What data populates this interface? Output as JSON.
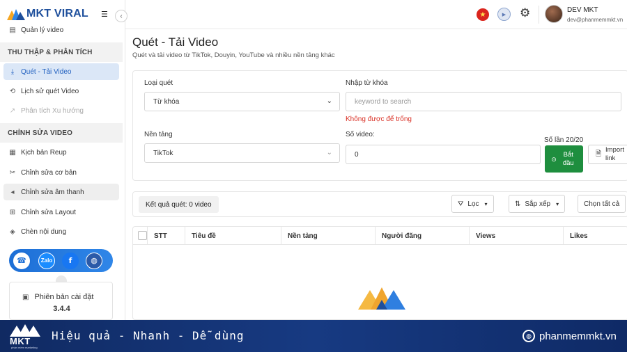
{
  "app": {
    "brand": "MKT VIRAL"
  },
  "sidebar": {
    "top_item": "Quản lý video",
    "sections": [
      {
        "title": "THU THẬP & PHÂN TÍCH",
        "items": [
          {
            "label": "Quét - Tải Video",
            "icon": "download-icon",
            "state": "active"
          },
          {
            "label": "Lịch sử quét Video",
            "icon": "history-icon",
            "state": "normal"
          },
          {
            "label": "Phân tích Xu hướng",
            "icon": "trend-icon",
            "state": "disabled"
          }
        ]
      },
      {
        "title": "CHỈNH SỬA VIDEO",
        "items": [
          {
            "label": "Kịch bản Reup",
            "icon": "script-icon",
            "state": "normal"
          },
          {
            "label": "Chỉnh sửa cơ bản",
            "icon": "scissors-icon",
            "state": "normal"
          },
          {
            "label": "Chỉnh sửa âm thanh",
            "icon": "speaker-icon",
            "state": "hover"
          },
          {
            "label": "Chỉnh sửa Layout",
            "icon": "layout-icon",
            "state": "normal"
          },
          {
            "label": "Chèn nội dung",
            "icon": "layers-icon",
            "state": "normal"
          }
        ]
      }
    ],
    "social": [
      "hotline-icon",
      "zalo-icon",
      "facebook-icon",
      "website-icon"
    ],
    "version": {
      "label": "Phiên bản cài đặt",
      "value": "3.4.4"
    }
  },
  "header": {
    "user_name": "DEV MKT",
    "user_email": "dev@phanmemmkt.vn"
  },
  "page": {
    "title": "Quét - Tải Video",
    "subtitle": "Quét và tải video từ TikTok, Douyin, YouTube và nhiều nền tảng khác"
  },
  "form": {
    "scan_type_label": "Loại quét",
    "scan_type_value": "Từ khóa",
    "keyword_label": "Nhập từ khóa",
    "keyword_placeholder": "keyword to search",
    "keyword_error": "Không được để trống",
    "platform_label": "Nền tảng",
    "platform_value": "TikTok",
    "video_count_label": "Số video:",
    "video_count_value": "0",
    "remaining_label": "Số lần 20/20",
    "start_button": "Bắt đầu",
    "import_button": "Import link"
  },
  "results": {
    "summary": "Kết quả quét: 0 video",
    "filter_button": "Lọc",
    "sort_button": "Sắp xếp",
    "select_all_button": "Chọn tất cả"
  },
  "table": {
    "columns": [
      "STT",
      "Tiêu đề",
      "Nền tảng",
      "Người đăng",
      "Views",
      "Likes"
    ]
  },
  "banner": {
    "logo_text": "MKT",
    "logo_subtext": "phần mềm marketing",
    "slogan": "Hiệu quả - Nhanh  - Dễ dùng",
    "website": "phanmemmkt.vn"
  },
  "colors": {
    "primary": "#1f5fbf",
    "active_bg": "#dbe7f7",
    "start_button": "#1e8e3e",
    "error": "#d93025",
    "banner": "#173a82"
  }
}
